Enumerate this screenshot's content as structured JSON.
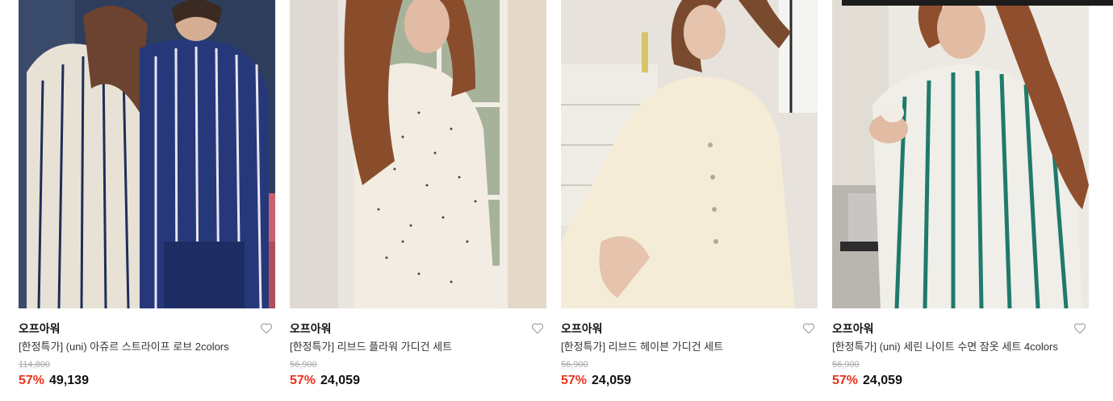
{
  "products": [
    {
      "brand": "오프아워",
      "title": "[한정특가] (uni) 아쥬르 스트라이프 로브 2colors",
      "original_price": "114,800",
      "discount": "57%",
      "price": "49,139",
      "image": "couple-striped-robes-photo"
    },
    {
      "brand": "오프아워",
      "title": "[한정특가] 리브드 플라워 가디건 세트",
      "original_price": "56,900",
      "discount": "57%",
      "price": "24,059",
      "image": "floral-cardigan-photo"
    },
    {
      "brand": "오프아워",
      "title": "[한정특가] 리브드 헤이븐 가디건 세트",
      "original_price": "56,900",
      "discount": "57%",
      "price": "24,059",
      "image": "cream-cardigan-photo"
    },
    {
      "brand": "오프아워",
      "title": "[한정특가] (uni) 세린 나이트 수면 잠옷 세트 4colors",
      "original_price": "56,900",
      "discount": "57%",
      "price": "24,059",
      "image": "green-striped-pajama-photo"
    }
  ],
  "icons": {
    "wishlist": "heart-outline-icon"
  },
  "colors": {
    "discount": "#e8331c",
    "strike_price": "#a8a8a8"
  }
}
